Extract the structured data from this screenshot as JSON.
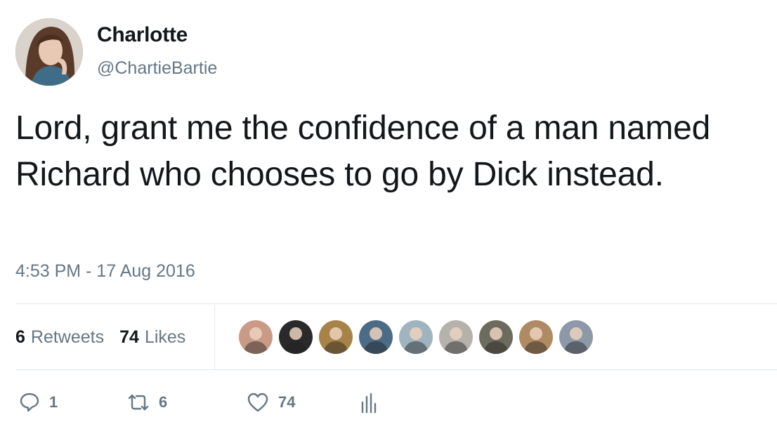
{
  "author": {
    "display_name": "Charlotte",
    "handle": "@ChartieBartie"
  },
  "tweet": {
    "text": "Lord, grant me the confidence of a man named Richard who chooses to go by Dick instead.",
    "timestamp": "4:53 PM - 17 Aug 2016"
  },
  "stats": {
    "retweets_count": "6",
    "retweets_label": "Retweets",
    "likes_count": "74",
    "likes_label": "Likes"
  },
  "likers": [
    {
      "icon": "liker-avatar-1",
      "color": "#c99a86"
    },
    {
      "icon": "liker-avatar-2",
      "color": "#2a2a2a"
    },
    {
      "icon": "liker-avatar-3",
      "color": "#a88348"
    },
    {
      "icon": "liker-avatar-4",
      "color": "#4b6b86"
    },
    {
      "icon": "liker-avatar-5",
      "color": "#9fb4bf"
    },
    {
      "icon": "liker-avatar-6",
      "color": "#b5b1ab"
    },
    {
      "icon": "liker-avatar-7",
      "color": "#6d6a5e"
    },
    {
      "icon": "liker-avatar-8",
      "color": "#b08a62"
    },
    {
      "icon": "liker-avatar-9",
      "color": "#8d98a8"
    }
  ],
  "actions": {
    "reply_count": "1",
    "retweet_count": "6",
    "like_count": "74"
  },
  "colors": {
    "text_primary": "#14171a",
    "text_secondary": "#657786",
    "divider": "#e1e8ed"
  }
}
